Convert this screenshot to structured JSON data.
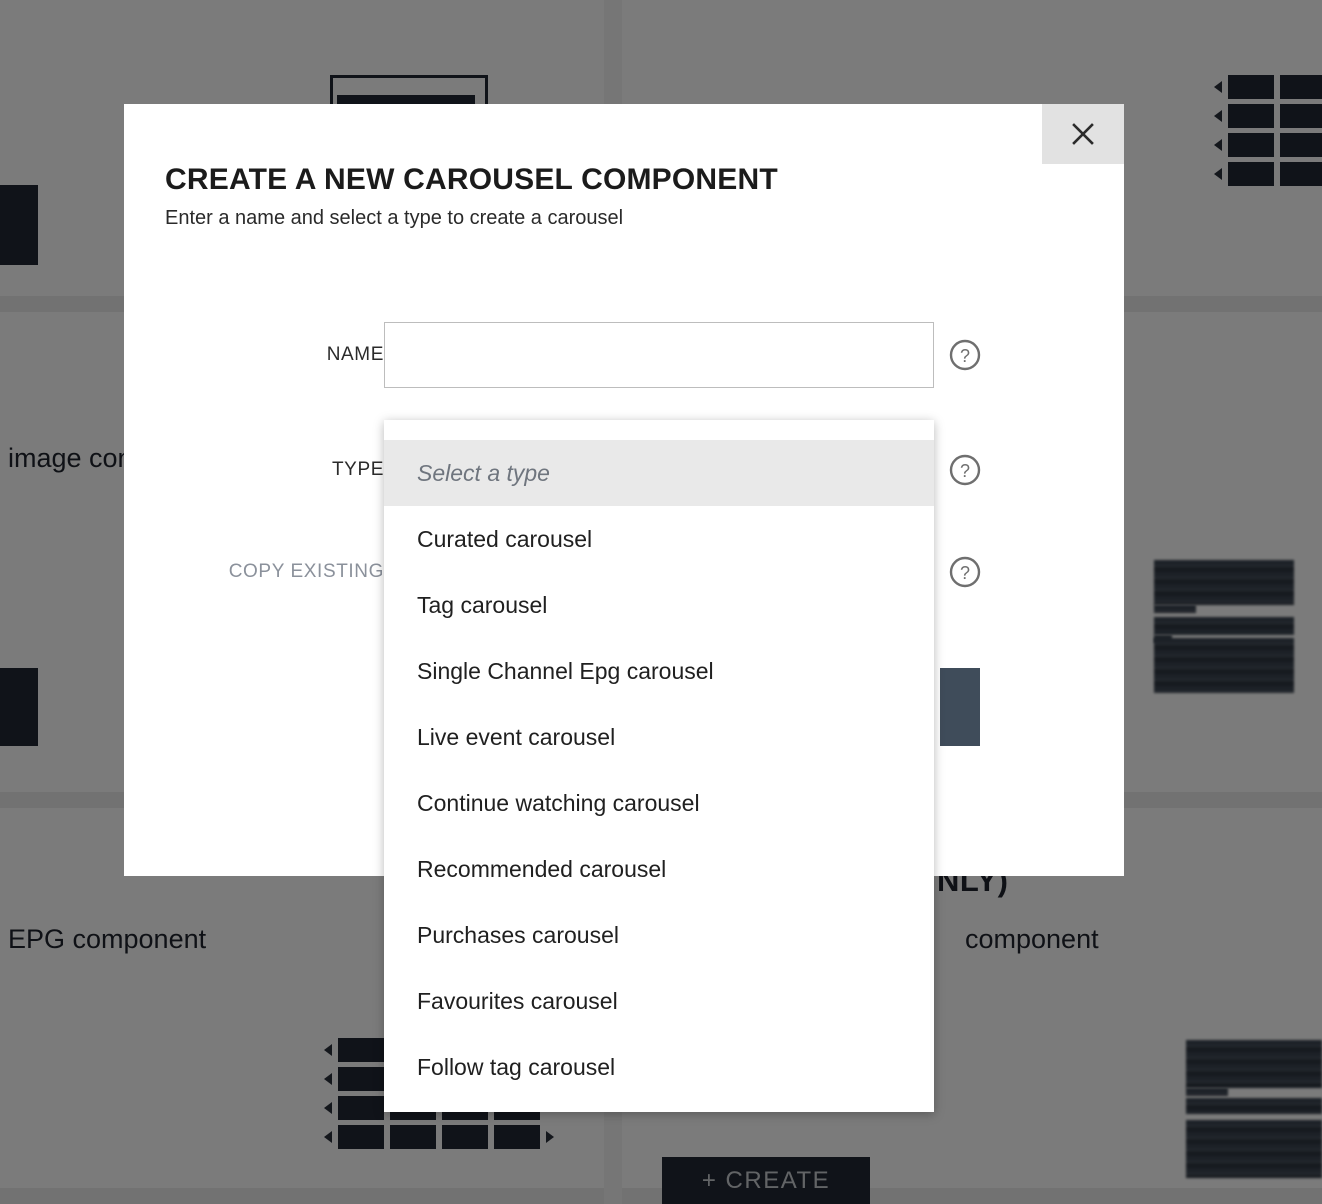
{
  "background": {
    "texts": [
      {
        "name": "image-component-label",
        "label": "image component"
      },
      {
        "name": "epg-component-label",
        "label": "EPG component"
      },
      {
        "name": "generic-component-label",
        "label": "component"
      }
    ],
    "headings": [
      {
        "name": "partial-heading-only",
        "label": "NLY)"
      }
    ],
    "create_button_label": "+ CREATE"
  },
  "modal": {
    "title": "CREATE A NEW CAROUSEL COMPONENT",
    "subtitle": "Enter a name and select a type to create a carousel",
    "close_icon": "close-icon",
    "help_icon": "help-circle-icon",
    "fields": [
      {
        "key": "name",
        "label": "NAME",
        "value": "",
        "placeholder": "",
        "disabled": false
      },
      {
        "key": "type",
        "label": "TYPE",
        "value": "",
        "placeholder": "Select a type",
        "disabled": false
      },
      {
        "key": "copy_existing",
        "label": "COPY EXISTING",
        "value": "",
        "placeholder": "",
        "disabled": true
      }
    ]
  },
  "dropdown": {
    "open": true,
    "placeholder": "Select a type",
    "selected": "",
    "options": [
      "Curated carousel",
      "Tag carousel",
      "Single Channel Epg carousel",
      "Live event carousel",
      "Continue watching carousel",
      "Recommended carousel",
      "Purchases carousel",
      "Favourites carousel",
      "Follow tag carousel"
    ]
  },
  "colors": {
    "modal_bg": "#ffffff",
    "overlay": "rgba(0,0,0,0.51)",
    "close_btn_bg": "#e2e2e2",
    "dropdown_highlight": "#e9e9e9",
    "muted_label": "#8b919b",
    "dark_accent": "#222834",
    "slate_accent": "#3f4c5a"
  }
}
